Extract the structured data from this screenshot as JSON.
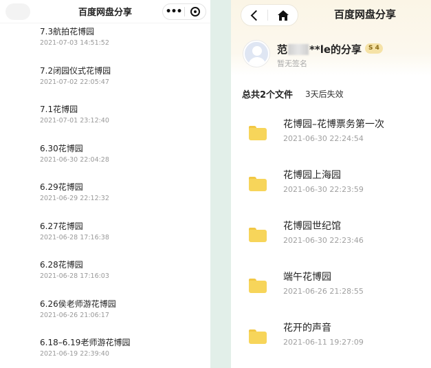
{
  "left": {
    "title": "百度网盘分享",
    "menu_dots": "•••",
    "items": [
      {
        "title": "7.3航拍花博园",
        "date": "2021-07-03 14:51:52"
      },
      {
        "title": "7.2闭园仪式花博园",
        "date": "2021-07-02 22:05:47"
      },
      {
        "title": "7.1花博园",
        "date": "2021-07-01 23:12:40"
      },
      {
        "title": "6.30花博园",
        "date": "2021-06-30 22:04:28"
      },
      {
        "title": "6.29花博园",
        "date": "2021-06-29 22:12:32"
      },
      {
        "title": "6.27花博园",
        "date": "2021-06-28 17:16:38"
      },
      {
        "title": "6.28花博园",
        "date": "2021-06-28 17:16:03"
      },
      {
        "title": "6.26侯老师游花博园",
        "date": "2021-06-26 21:06:17"
      },
      {
        "title": "6.18–6.19老师游花博园",
        "date": "2021-06-19 22:39:40"
      }
    ]
  },
  "right": {
    "title": "百度网盘分享",
    "user": {
      "name_prefix": "范",
      "name_suffix": "**le的分享",
      "badge": "S 4",
      "signature": "暂无签名"
    },
    "summary": "总共2个文件",
    "expire": "3天后失效",
    "files": [
      {
        "name": "花博园–花博票务第一次",
        "date": "2021-06-30 22:24:54"
      },
      {
        "name": "花博园上海园",
        "date": "2021-06-30 22:23:59"
      },
      {
        "name": "花博园世纪馆",
        "date": "2021-06-30 22:23:46"
      },
      {
        "name": "端午花博园",
        "date": "2021-06-26 21:28:55"
      },
      {
        "name": "花开的声音",
        "date": "2021-06-11 19:27:09"
      }
    ],
    "colors": {
      "folder": "#f7d55a",
      "header_bg": "#fbf5e6",
      "badge_bg": "#f5e2a6"
    }
  }
}
